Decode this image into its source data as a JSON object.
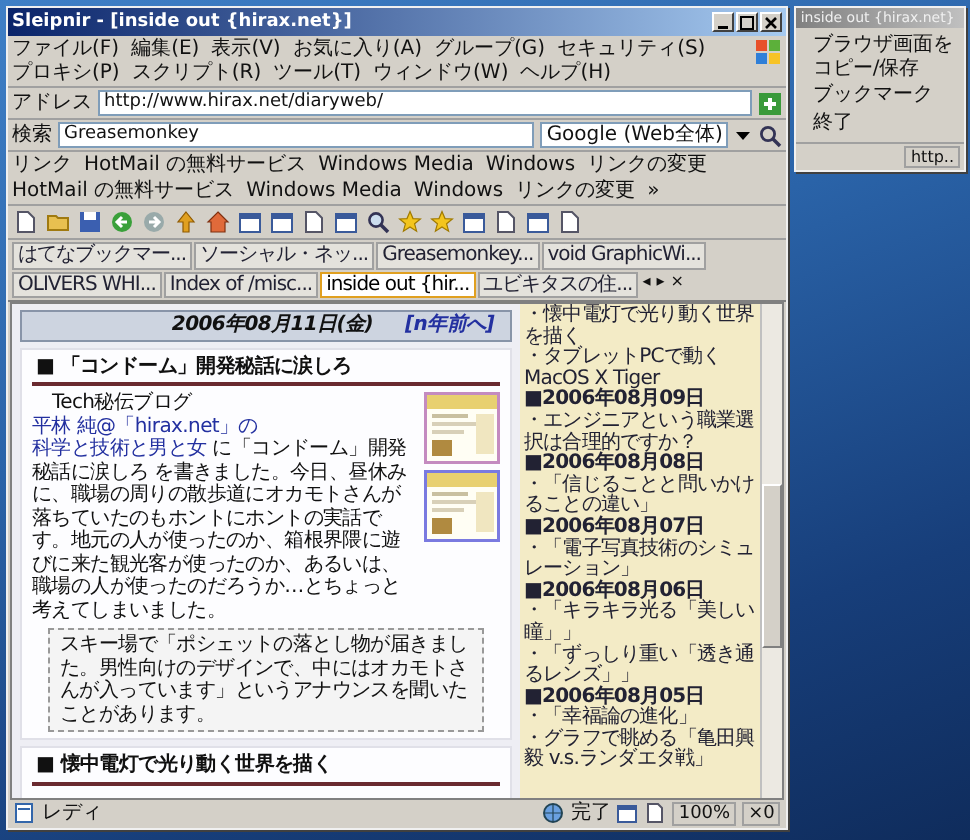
{
  "browser": {
    "title": "Sleipnir - [inside out {hirax.net}]",
    "menu": [
      "ファイル(F)",
      "編集(E)",
      "表示(V)",
      "お気に入り(A)",
      "グループ(G)",
      "セキュリティ(S)",
      "プロキシ(P)",
      "スクリプト(R)",
      "ツール(T)",
      "ウィンドウ(W)",
      "ヘルプ(H)"
    ],
    "address": {
      "label": "アドレス",
      "value": "http://www.hirax.net/diaryweb/"
    },
    "search": {
      "label": "検索",
      "value": "Greasemonkey",
      "engine": "Google (Web全体)"
    },
    "links": {
      "label": "リンク",
      "items": [
        "HotMail の無料サービス",
        "Windows Media",
        "Windows",
        "リンクの変更",
        "HotMail の無料サービス",
        "Windows Media",
        "Windows",
        "リンクの変更"
      ],
      "more": "»"
    },
    "tabs": [
      {
        "label": "はてなブックマー...",
        "selected": false
      },
      {
        "label": "ソーシャル・ネッ...",
        "selected": false
      },
      {
        "label": "Greasemonkey...",
        "selected": false
      },
      {
        "label": "void GraphicWi...",
        "selected": false
      },
      {
        "label": "OLIVERS WHI...",
        "selected": false
      },
      {
        "label": "Index of /misc...",
        "selected": false
      },
      {
        "label": "inside out {hir...",
        "selected": true
      },
      {
        "label": "ユビキタスの住...",
        "selected": false
      }
    ],
    "tab_buttons": [
      "◂",
      "▸",
      "×"
    ],
    "page": {
      "date": "2006年08月11日(金)",
      "prev_link": "[n年前へ]",
      "articles": [
        {
          "title": "■ 「コンドーム」開発秘話に涙しろ",
          "body": [
            {
              "kind": "text",
              "text": "Tech秘伝ブログ "
            },
            {
              "kind": "link",
              "text": "平林 純@「hirax.net」の"
            },
            {
              "kind": "link",
              "text": "科学と技術と男と女"
            },
            {
              "kind": "text",
              "text": " に「コンドーム」開発秘話に涙しろ を書きました。今日、昼休みに、職場の周りの散歩道にオカモトさんが落ちていたのもホントにホントの実話です。地元の人が使ったのか、箱根界隈に遊びに来た観光客が使ったのか、あるいは、職場の人が使ったのだろうか…とちょっと考えてしまいました。"
            }
          ],
          "quote": "スキー場で「ポシェットの落とし物が届きました。男性向けのデザインで、中にはオカモトさんが入っています」というアナウンスを聞いたことがあります。"
        },
        {
          "title": "■ 懐中電灯で光り動く世界を描く"
        }
      ]
    },
    "sidebar": [
      {
        "kind": "post",
        "text": "・懐中電灯で光り動く世界を描く"
      },
      {
        "kind": "post",
        "text": "・タブレットPCで動くMacOS X Tiger"
      },
      {
        "kind": "date",
        "text": "■2006年08月09日"
      },
      {
        "kind": "post",
        "text": "・エンジニアという職業選択は合理的ですか？"
      },
      {
        "kind": "date",
        "text": "■2006年08月08日"
      },
      {
        "kind": "post",
        "text": "・「信じることと問いかけることの違い」"
      },
      {
        "kind": "date",
        "text": "■2006年08月07日"
      },
      {
        "kind": "post",
        "text": "・「電子写真技術のシミュレーション」"
      },
      {
        "kind": "date",
        "text": "■2006年08月06日"
      },
      {
        "kind": "post",
        "text": "・「キラキラ光る「美しい瞳」」"
      },
      {
        "kind": "post",
        "text": "・「ずっしり重い「透き通るレンズ」」"
      },
      {
        "kind": "date",
        "text": "■2006年08月05日"
      },
      {
        "kind": "post",
        "text": "・「幸福論の進化」"
      },
      {
        "kind": "post",
        "text": "・グラフで眺める「亀田興毅 v.s.ランダエタ戦」"
      }
    ],
    "status": {
      "text": "レディ",
      "done": "完了",
      "zoom": "100%",
      "count": "×0"
    }
  },
  "popup": {
    "title": "inside out {hirax.net}",
    "items": [
      "ブラウザ画面をコピー/保存",
      "ブックマーク",
      "終了"
    ],
    "status": "http.."
  }
}
